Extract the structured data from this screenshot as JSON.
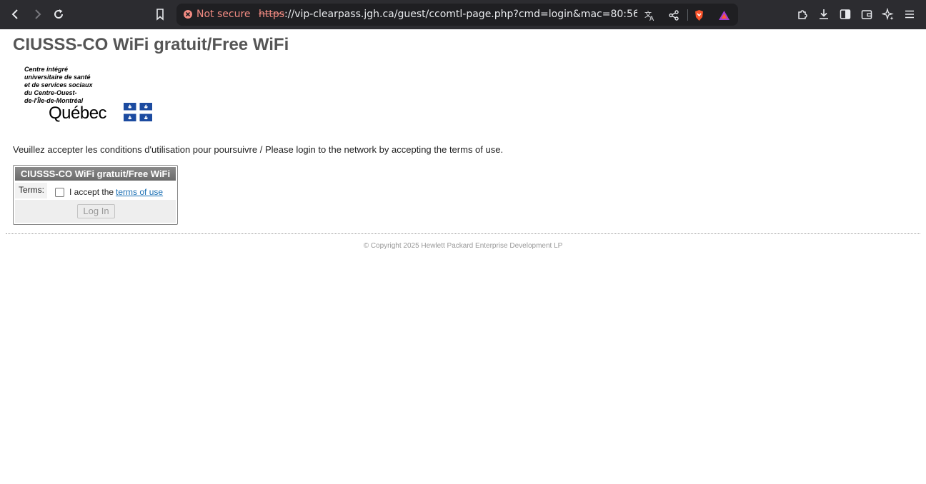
{
  "browser": {
    "security_label": "Not secure",
    "url_protocol": "https",
    "url_rest": "://vip-clearpass.jgh.ca/guest/ccomtl-page.php?cmd=login&mac=80:56:f2:74:...",
    "icons": {
      "back": "back-arrow-icon",
      "forward": "forward-arrow-icon",
      "reload": "reload-icon",
      "bookmark": "bookmark-icon",
      "not_secure": "warning-icon",
      "translate": "translate-icon",
      "share": "share-icon",
      "brave": "brave-shield-icon",
      "rewards": "brave-rewards-icon",
      "extensions": "puzzle-icon",
      "downloads": "download-icon",
      "sidebar": "sidebar-icon",
      "wallet": "wallet-icon",
      "leo": "sparkle-icon",
      "menu": "hamburger-menu-icon"
    },
    "colors": {
      "toolbar": "#2c2c30",
      "omnibox": "#1f1f22",
      "insecure": "#f28b82"
    }
  },
  "page": {
    "title": "CIUSSS-CO WiFi gratuit/Free WiFi",
    "logo": {
      "lines": [
        "Centre intégré",
        "universitaire de santé",
        "et de services sociaux",
        "du Centre-Ouest-",
        "de-l'Île-de-Montréal"
      ],
      "wordmark": "Québec",
      "flag_color": "#1c4ba0"
    },
    "intro": "Veuillez accepter les conditions d'utilisation pour poursuivre / Please login to the network by accepting the terms of use.",
    "form": {
      "header": "CIUSSS-CO WiFi gratuit/Free WiFi",
      "terms_label": "Terms:",
      "accept_text": "I accept the",
      "terms_link": "terms of use",
      "checkbox_checked": false,
      "login_button": "Log In"
    },
    "copyright": "© Copyright 2025 Hewlett Packard Enterprise Development LP"
  }
}
